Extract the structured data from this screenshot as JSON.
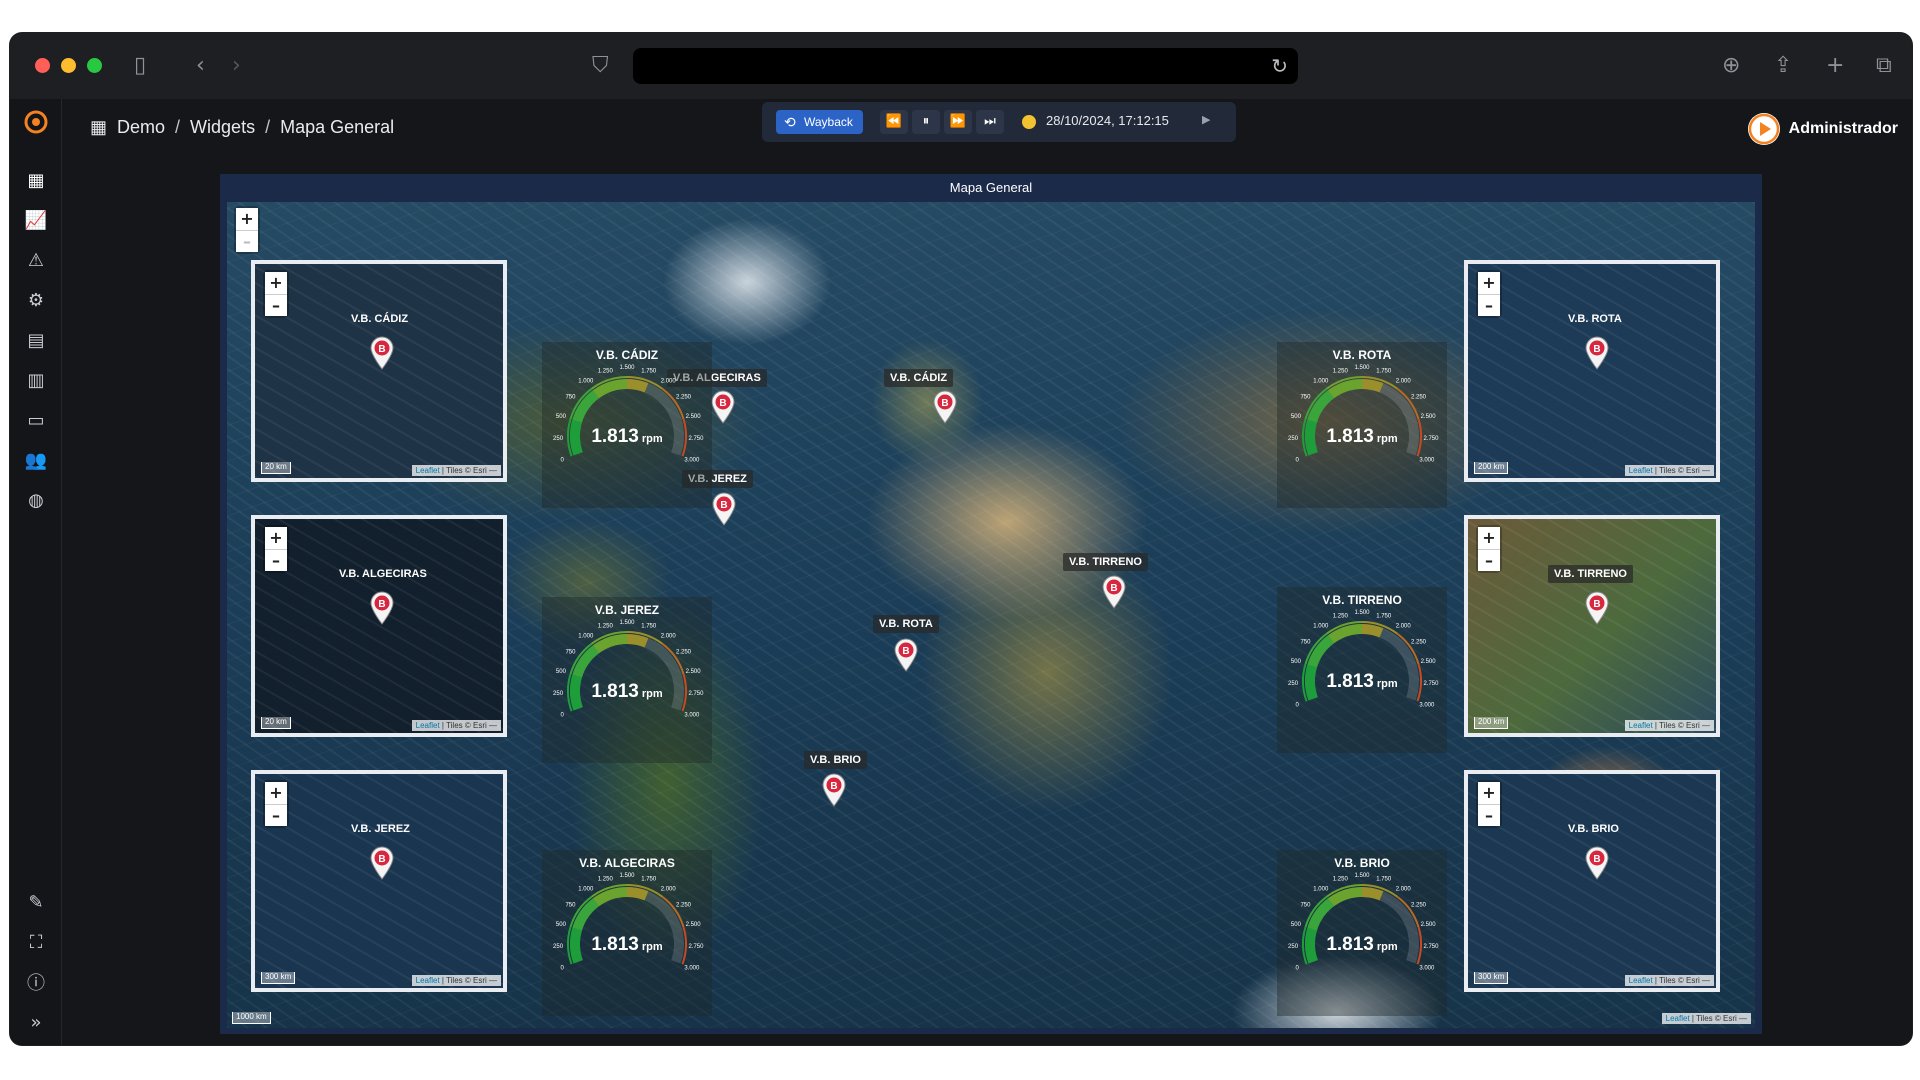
{
  "breadcrumb": [
    "Demo",
    "Widgets",
    "Mapa General"
  ],
  "breadcrumb_sep": "/",
  "wayback": {
    "label": "Wayback",
    "datetime": "28/10/2024, 17:12:15",
    "status_color": "#f2c230"
  },
  "user": {
    "name": "Administrador"
  },
  "widget": {
    "title": "Mapa General"
  },
  "map": {
    "zoom_in": "+",
    "zoom_out": "–",
    "scale": "1000 km",
    "attribution": {
      "leaflet": "Leaflet",
      "tiles": "| Tiles © Esri —"
    },
    "markers": [
      "V.B. CÁDIZ",
      "V.B. ALGECIRAS",
      "V.B. JEREZ",
      "V.B. CÁDIZ",
      "V.B. ROTA",
      "V.B. TIRRENO",
      "V.B. BRIO"
    ],
    "marker_letter": "B"
  },
  "gauges": [
    {
      "title": "V.B. CÁDIZ",
      "value": "1.813",
      "unit": "rpm",
      "fraction": 0.6
    },
    {
      "title": "V.B. JEREZ",
      "value": "1.813",
      "unit": "rpm",
      "fraction": 0.6
    },
    {
      "title": "V.B. ALGECIRAS",
      "value": "1.813",
      "unit": "rpm",
      "fraction": 0.6
    },
    {
      "title": "V.B. ROTA",
      "value": "1.813",
      "unit": "rpm",
      "fraction": 0.6
    },
    {
      "title": "V.B. TIRRENO",
      "value": "1.813",
      "unit": "rpm",
      "fraction": 0.6
    },
    {
      "title": "V.B. BRIO",
      "value": "1.813",
      "unit": "rpm",
      "fraction": 0.6
    }
  ],
  "gauge_ticks": [
    "0",
    "250",
    "500",
    "750",
    "1.000",
    "1.250",
    "1.500",
    "1.750",
    "2.000",
    "2.250",
    "2.500",
    "2.750",
    "3.000"
  ],
  "minimaps": [
    {
      "label": "V.B. CÁDIZ",
      "scale": "20 km"
    },
    {
      "label": "V.B. ALGECIRAS",
      "scale": "20 km"
    },
    {
      "label": "V.B. JEREZ",
      "scale": "300 km"
    },
    {
      "label": "V.B. ROTA",
      "scale": "200 km"
    },
    {
      "label": "V.B. TIRRENO",
      "scale": "200 km"
    },
    {
      "label": "V.B. BRIO",
      "scale": "300 km"
    }
  ],
  "colors": {
    "accent": "#2b63c7",
    "marker": "#d7263d",
    "brand": "#f58220"
  }
}
